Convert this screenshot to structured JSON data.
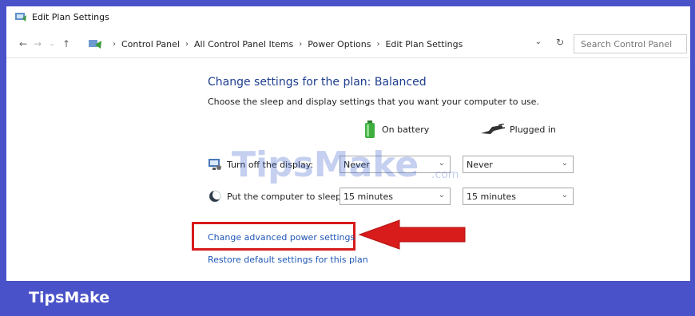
{
  "window": {
    "title": "Edit Plan Settings"
  },
  "nav": {
    "breadcrumbs": [
      "Control Panel",
      "All Control Panel Items",
      "Power Options",
      "Edit Plan Settings"
    ],
    "search_placeholder": "Search Control Panel"
  },
  "content": {
    "heading": "Change settings for the plan: Balanced",
    "subheading": "Choose the sleep and display settings that you want your computer to use.",
    "columns": {
      "battery": "On battery",
      "plugged": "Plugged in"
    },
    "rows": [
      {
        "label": "Turn off the display:",
        "battery_value": "Never",
        "plugged_value": "Never"
      },
      {
        "label": "Put the computer to sleep:",
        "battery_value": "15 minutes",
        "plugged_value": "15 minutes"
      }
    ],
    "advanced_link": "Change advanced power settings",
    "restore_link": "Restore default settings for this plan"
  },
  "watermark": {
    "brand": "TipsMake",
    "suffix": ".com"
  },
  "footer": {
    "brand": "TipsMake"
  },
  "colors": {
    "frame": "#4a52c9",
    "heading": "#1e3d8f",
    "link": "#1e56b5",
    "highlight": "#d81b1b"
  }
}
